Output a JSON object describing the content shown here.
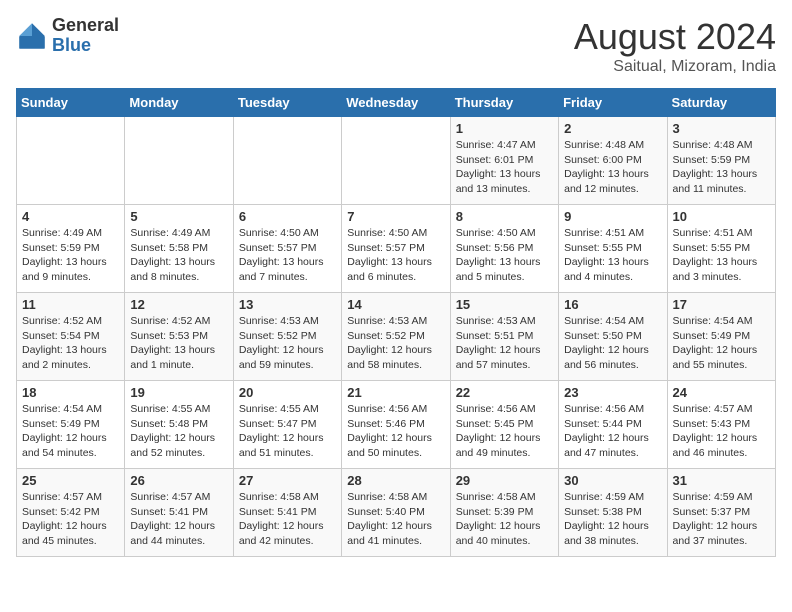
{
  "header": {
    "logo_general": "General",
    "logo_blue": "Blue",
    "title": "August 2024",
    "subtitle": "Saitual, Mizoram, India"
  },
  "weekdays": [
    "Sunday",
    "Monday",
    "Tuesday",
    "Wednesday",
    "Thursday",
    "Friday",
    "Saturday"
  ],
  "weeks": [
    [
      {
        "day": "",
        "info": ""
      },
      {
        "day": "",
        "info": ""
      },
      {
        "day": "",
        "info": ""
      },
      {
        "day": "",
        "info": ""
      },
      {
        "day": "1",
        "info": "Sunrise: 4:47 AM\nSunset: 6:01 PM\nDaylight: 13 hours and 13 minutes."
      },
      {
        "day": "2",
        "info": "Sunrise: 4:48 AM\nSunset: 6:00 PM\nDaylight: 13 hours and 12 minutes."
      },
      {
        "day": "3",
        "info": "Sunrise: 4:48 AM\nSunset: 5:59 PM\nDaylight: 13 hours and 11 minutes."
      }
    ],
    [
      {
        "day": "4",
        "info": "Sunrise: 4:49 AM\nSunset: 5:59 PM\nDaylight: 13 hours and 9 minutes."
      },
      {
        "day": "5",
        "info": "Sunrise: 4:49 AM\nSunset: 5:58 PM\nDaylight: 13 hours and 8 minutes."
      },
      {
        "day": "6",
        "info": "Sunrise: 4:50 AM\nSunset: 5:57 PM\nDaylight: 13 hours and 7 minutes."
      },
      {
        "day": "7",
        "info": "Sunrise: 4:50 AM\nSunset: 5:57 PM\nDaylight: 13 hours and 6 minutes."
      },
      {
        "day": "8",
        "info": "Sunrise: 4:50 AM\nSunset: 5:56 PM\nDaylight: 13 hours and 5 minutes."
      },
      {
        "day": "9",
        "info": "Sunrise: 4:51 AM\nSunset: 5:55 PM\nDaylight: 13 hours and 4 minutes."
      },
      {
        "day": "10",
        "info": "Sunrise: 4:51 AM\nSunset: 5:55 PM\nDaylight: 13 hours and 3 minutes."
      }
    ],
    [
      {
        "day": "11",
        "info": "Sunrise: 4:52 AM\nSunset: 5:54 PM\nDaylight: 13 hours and 2 minutes."
      },
      {
        "day": "12",
        "info": "Sunrise: 4:52 AM\nSunset: 5:53 PM\nDaylight: 13 hours and 1 minute."
      },
      {
        "day": "13",
        "info": "Sunrise: 4:53 AM\nSunset: 5:52 PM\nDaylight: 12 hours and 59 minutes."
      },
      {
        "day": "14",
        "info": "Sunrise: 4:53 AM\nSunset: 5:52 PM\nDaylight: 12 hours and 58 minutes."
      },
      {
        "day": "15",
        "info": "Sunrise: 4:53 AM\nSunset: 5:51 PM\nDaylight: 12 hours and 57 minutes."
      },
      {
        "day": "16",
        "info": "Sunrise: 4:54 AM\nSunset: 5:50 PM\nDaylight: 12 hours and 56 minutes."
      },
      {
        "day": "17",
        "info": "Sunrise: 4:54 AM\nSunset: 5:49 PM\nDaylight: 12 hours and 55 minutes."
      }
    ],
    [
      {
        "day": "18",
        "info": "Sunrise: 4:54 AM\nSunset: 5:49 PM\nDaylight: 12 hours and 54 minutes."
      },
      {
        "day": "19",
        "info": "Sunrise: 4:55 AM\nSunset: 5:48 PM\nDaylight: 12 hours and 52 minutes."
      },
      {
        "day": "20",
        "info": "Sunrise: 4:55 AM\nSunset: 5:47 PM\nDaylight: 12 hours and 51 minutes."
      },
      {
        "day": "21",
        "info": "Sunrise: 4:56 AM\nSunset: 5:46 PM\nDaylight: 12 hours and 50 minutes."
      },
      {
        "day": "22",
        "info": "Sunrise: 4:56 AM\nSunset: 5:45 PM\nDaylight: 12 hours and 49 minutes."
      },
      {
        "day": "23",
        "info": "Sunrise: 4:56 AM\nSunset: 5:44 PM\nDaylight: 12 hours and 47 minutes."
      },
      {
        "day": "24",
        "info": "Sunrise: 4:57 AM\nSunset: 5:43 PM\nDaylight: 12 hours and 46 minutes."
      }
    ],
    [
      {
        "day": "25",
        "info": "Sunrise: 4:57 AM\nSunset: 5:42 PM\nDaylight: 12 hours and 45 minutes."
      },
      {
        "day": "26",
        "info": "Sunrise: 4:57 AM\nSunset: 5:41 PM\nDaylight: 12 hours and 44 minutes."
      },
      {
        "day": "27",
        "info": "Sunrise: 4:58 AM\nSunset: 5:41 PM\nDaylight: 12 hours and 42 minutes."
      },
      {
        "day": "28",
        "info": "Sunrise: 4:58 AM\nSunset: 5:40 PM\nDaylight: 12 hours and 41 minutes."
      },
      {
        "day": "29",
        "info": "Sunrise: 4:58 AM\nSunset: 5:39 PM\nDaylight: 12 hours and 40 minutes."
      },
      {
        "day": "30",
        "info": "Sunrise: 4:59 AM\nSunset: 5:38 PM\nDaylight: 12 hours and 38 minutes."
      },
      {
        "day": "31",
        "info": "Sunrise: 4:59 AM\nSunset: 5:37 PM\nDaylight: 12 hours and 37 minutes."
      }
    ]
  ]
}
